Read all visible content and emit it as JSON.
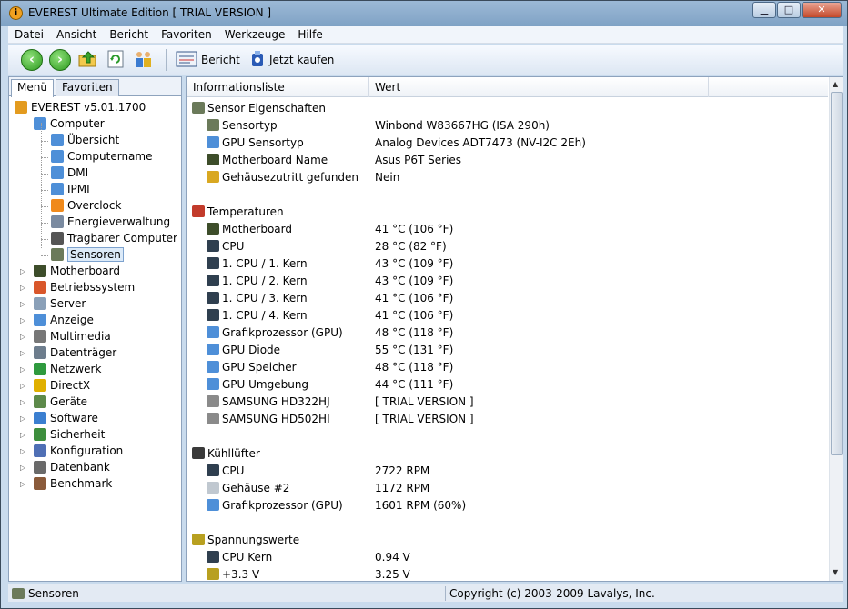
{
  "window": {
    "title": "EVEREST Ultimate Edition  [ TRIAL VERSION ]",
    "app_icon": "info-icon",
    "controls": [
      "minimize-icon",
      "maximize-icon",
      "close-icon"
    ]
  },
  "menu": [
    "Datei",
    "Ansicht",
    "Bericht",
    "Favoriten",
    "Werkzeuge",
    "Hilfe"
  ],
  "toolbar": {
    "back_icon": "arrow-left-icon",
    "forward_icon": "arrow-right-icon",
    "up_icon": "folder-up-icon",
    "refresh_icon": "refresh-icon",
    "users_icon": "users-icon",
    "report_label": "Bericht",
    "buy_label": "Jetzt kaufen"
  },
  "left": {
    "tabs": [
      "Menü",
      "Favoriten"
    ],
    "tree": [
      {
        "label": "EVEREST v5.01.1700",
        "level": 0,
        "icon": "info-icon",
        "color": "#e39b1f"
      },
      {
        "label": "Computer",
        "level": 1,
        "icon": "computer-icon",
        "color": "#4e8fd8",
        "expanded": true
      },
      {
        "label": "Übersicht",
        "level": 2,
        "icon": "computer-icon",
        "color": "#4e8fd8"
      },
      {
        "label": "Computername",
        "level": 2,
        "icon": "computer-icon",
        "color": "#4e8fd8"
      },
      {
        "label": "DMI",
        "level": 2,
        "icon": "computer-icon",
        "color": "#4e8fd8"
      },
      {
        "label": "IPMI",
        "level": 2,
        "icon": "computer-icon",
        "color": "#4e8fd8"
      },
      {
        "label": "Overclock",
        "level": 2,
        "icon": "flame-icon",
        "color": "#f08a1c"
      },
      {
        "label": "Energieverwaltung",
        "level": 2,
        "icon": "power-icon",
        "color": "#7a8aa0"
      },
      {
        "label": "Tragbarer Computer",
        "level": 2,
        "icon": "laptop-icon",
        "color": "#555555"
      },
      {
        "label": "Sensoren",
        "level": 2,
        "icon": "chip-icon",
        "color": "#6b7a5a",
        "selected": true
      },
      {
        "label": "Motherboard",
        "level": 1,
        "icon": "motherboard-icon",
        "color": "#3d4d2a"
      },
      {
        "label": "Betriebssystem",
        "level": 1,
        "icon": "windows-icon",
        "color": "#d9572b"
      },
      {
        "label": "Server",
        "level": 1,
        "icon": "server-icon",
        "color": "#8aa0b8"
      },
      {
        "label": "Anzeige",
        "level": 1,
        "icon": "monitor-icon",
        "color": "#4e8fd8"
      },
      {
        "label": "Multimedia",
        "level": 1,
        "icon": "speaker-icon",
        "color": "#777777"
      },
      {
        "label": "Datenträger",
        "level": 1,
        "icon": "disk-icon",
        "color": "#6d7d8d"
      },
      {
        "label": "Netzwerk",
        "level": 1,
        "icon": "globe-icon",
        "color": "#2f9a3e"
      },
      {
        "label": "DirectX",
        "level": 1,
        "icon": "directx-icon",
        "color": "#e0b000"
      },
      {
        "label": "Geräte",
        "level": 1,
        "icon": "devices-icon",
        "color": "#5d8a4a"
      },
      {
        "label": "Software",
        "level": 1,
        "icon": "software-icon",
        "color": "#3b7fd0"
      },
      {
        "label": "Sicherheit",
        "level": 1,
        "icon": "shield-icon",
        "color": "#3e8f3e"
      },
      {
        "label": "Konfiguration",
        "level": 1,
        "icon": "config-icon",
        "color": "#4f6fb5"
      },
      {
        "label": "Datenbank",
        "level": 1,
        "icon": "database-icon",
        "color": "#6a6a6a"
      },
      {
        "label": "Benchmark",
        "level": 1,
        "icon": "hourglass-icon",
        "color": "#8a5a3a"
      }
    ]
  },
  "right": {
    "columns": [
      "Informationsliste",
      "Wert"
    ],
    "sections": [
      {
        "title": "Sensor Eigenschaften",
        "icon": "chip-icon",
        "color": "#6b7a5a",
        "rows": [
          {
            "k": "Sensortyp",
            "v": "Winbond W83667HG  (ISA 290h)",
            "icon": "chip-icon",
            "color": "#6b7a5a"
          },
          {
            "k": "GPU Sensortyp",
            "v": "Analog Devices ADT7473  (NV-I2C 2Eh)",
            "icon": "gpu-icon",
            "color": "#4e8fd8"
          },
          {
            "k": "Motherboard Name",
            "v": "Asus P6T Series",
            "icon": "motherboard-icon",
            "color": "#3d4d2a"
          },
          {
            "k": "Gehäusezutritt gefunden",
            "v": "Nein",
            "icon": "lock-icon",
            "color": "#d9a821"
          }
        ]
      },
      {
        "title": "Temperaturen",
        "icon": "thermometer-icon",
        "color": "#c23b2b",
        "rows": [
          {
            "k": "Motherboard",
            "v": "41 °C  (106 °F)",
            "icon": "motherboard-icon",
            "color": "#3d4d2a"
          },
          {
            "k": "CPU",
            "v": "28 °C  (82 °F)",
            "icon": "cpu-icon",
            "color": "#2f3f4f"
          },
          {
            "k": "1. CPU / 1. Kern",
            "v": "43 °C  (109 °F)",
            "icon": "cpu-icon",
            "color": "#2f3f4f"
          },
          {
            "k": "1. CPU / 2. Kern",
            "v": "43 °C  (109 °F)",
            "icon": "cpu-icon",
            "color": "#2f3f4f"
          },
          {
            "k": "1. CPU / 3. Kern",
            "v": "41 °C  (106 °F)",
            "icon": "cpu-icon",
            "color": "#2f3f4f"
          },
          {
            "k": "1. CPU / 4. Kern",
            "v": "41 °C  (106 °F)",
            "icon": "cpu-icon",
            "color": "#2f3f4f"
          },
          {
            "k": "Grafikprozessor (GPU)",
            "v": "48 °C  (118 °F)",
            "icon": "gpu-icon",
            "color": "#4e8fd8"
          },
          {
            "k": "GPU Diode",
            "v": "55 °C  (131 °F)",
            "icon": "gpu-icon",
            "color": "#4e8fd8"
          },
          {
            "k": "GPU Speicher",
            "v": "48 °C  (118 °F)",
            "icon": "gpu-icon",
            "color": "#4e8fd8"
          },
          {
            "k": "GPU Umgebung",
            "v": "44 °C  (111 °F)",
            "icon": "gpu-icon",
            "color": "#4e8fd8"
          },
          {
            "k": "SAMSUNG HD322HJ",
            "v": "[ TRIAL VERSION ]",
            "icon": "disk-icon",
            "color": "#8a8a8a"
          },
          {
            "k": "SAMSUNG HD502HI",
            "v": "[ TRIAL VERSION ]",
            "icon": "disk-icon",
            "color": "#8a8a8a"
          }
        ]
      },
      {
        "title": "Kühllüfter",
        "icon": "fan-icon",
        "color": "#3a3a3a",
        "rows": [
          {
            "k": "CPU",
            "v": "2722 RPM",
            "icon": "cpu-icon",
            "color": "#2f3f4f"
          },
          {
            "k": "Gehäuse #2",
            "v": "1172 RPM",
            "icon": "case-icon",
            "color": "#c0c8d0"
          },
          {
            "k": "Grafikprozessor (GPU)",
            "v": "1601 RPM  (60%)",
            "icon": "gpu-icon",
            "color": "#4e8fd8"
          }
        ]
      },
      {
        "title": "Spannungswerte",
        "icon": "voltage-icon",
        "color": "#b8a020",
        "rows": [
          {
            "k": "CPU Kern",
            "v": "0.94 V",
            "icon": "cpu-icon",
            "color": "#2f3f4f"
          },
          {
            "k": "+3.3 V",
            "v": "3.25 V",
            "icon": "voltage-icon",
            "color": "#b8a020"
          }
        ]
      }
    ]
  },
  "status": {
    "left": "Sensoren",
    "right": "Copyright (c) 2003-2009 Lavalys, Inc."
  }
}
